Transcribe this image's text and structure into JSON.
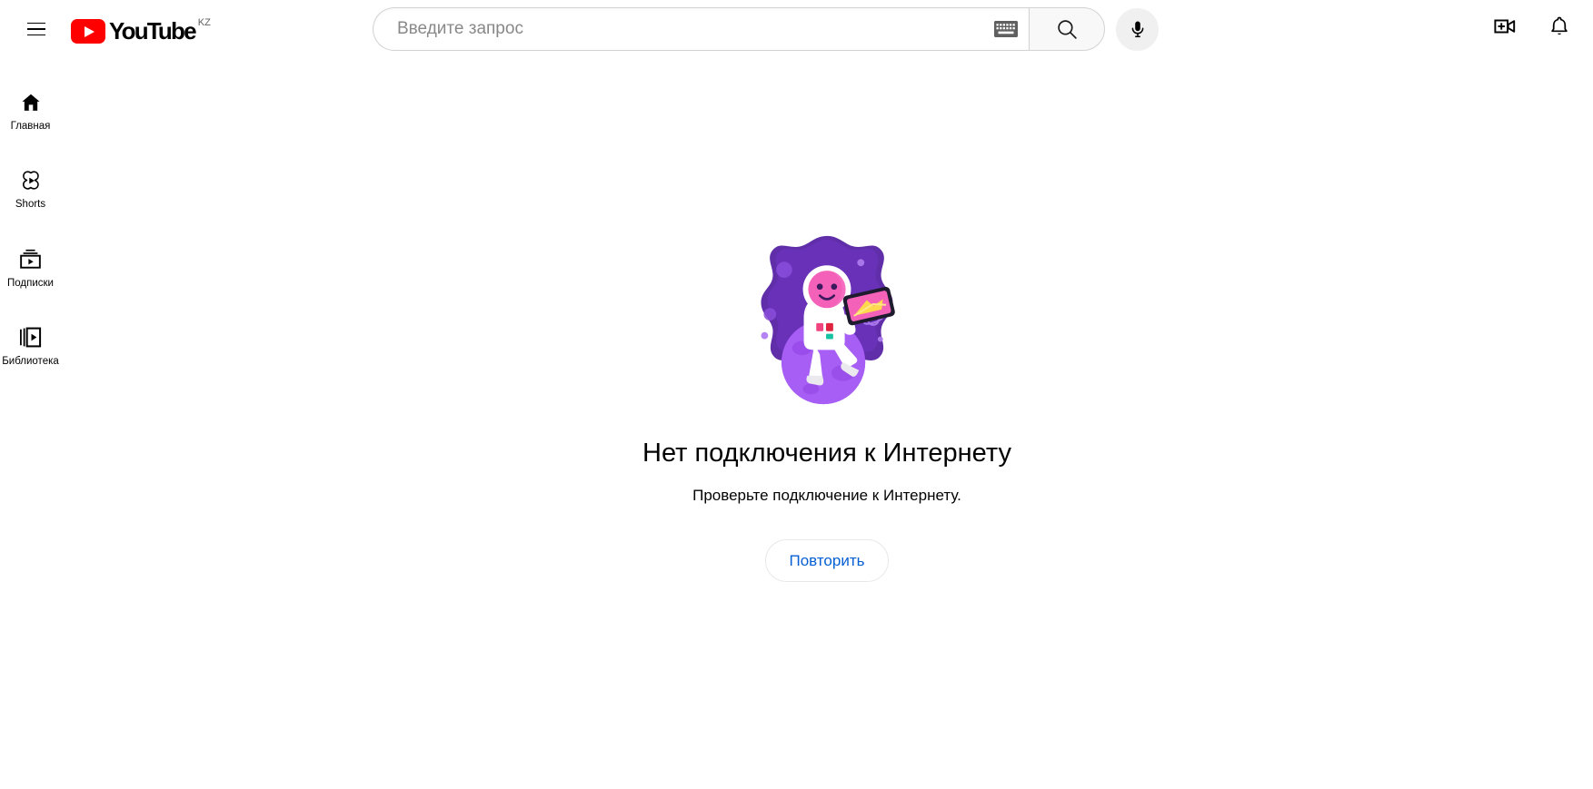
{
  "header": {
    "menu_label": "Главное меню",
    "logo_text": "YouTube",
    "logo_country": "KZ",
    "search": {
      "placeholder": "Введите запрос",
      "value": "",
      "search_button_label": "Поиск",
      "keyboard_button_label": "Экранная клавиатура",
      "voice_button_label": "Голосовой поиск"
    },
    "create_label": "Создать",
    "notifications_label": "Уведомления"
  },
  "sidebar": {
    "items": [
      {
        "id": "home",
        "label": "Главная",
        "icon": "home-icon"
      },
      {
        "id": "shorts",
        "label": "Shorts",
        "icon": "shorts-icon"
      },
      {
        "id": "subscriptions",
        "label": "Подписки",
        "icon": "subscriptions-icon"
      },
      {
        "id": "library",
        "label": "Библиотека",
        "icon": "library-icon"
      }
    ]
  },
  "main": {
    "illustration_name": "astronaut-on-planet-offline-illustration",
    "title": "Нет подключения к Интернету",
    "subtitle": "Проверьте подключение к Интернету.",
    "retry_button": "Повторить"
  },
  "colors": {
    "brand_red": "#ff0000",
    "link_blue": "#065fd4",
    "text_primary": "#030303",
    "text_secondary": "#606060",
    "illustration_dark_purple": "#5a2d9e",
    "illustration_mid_purple": "#7b3fd4",
    "illustration_light_purple": "#a45cf0",
    "illustration_pink": "#f461b8",
    "illustration_yellow": "#ffd84d"
  }
}
